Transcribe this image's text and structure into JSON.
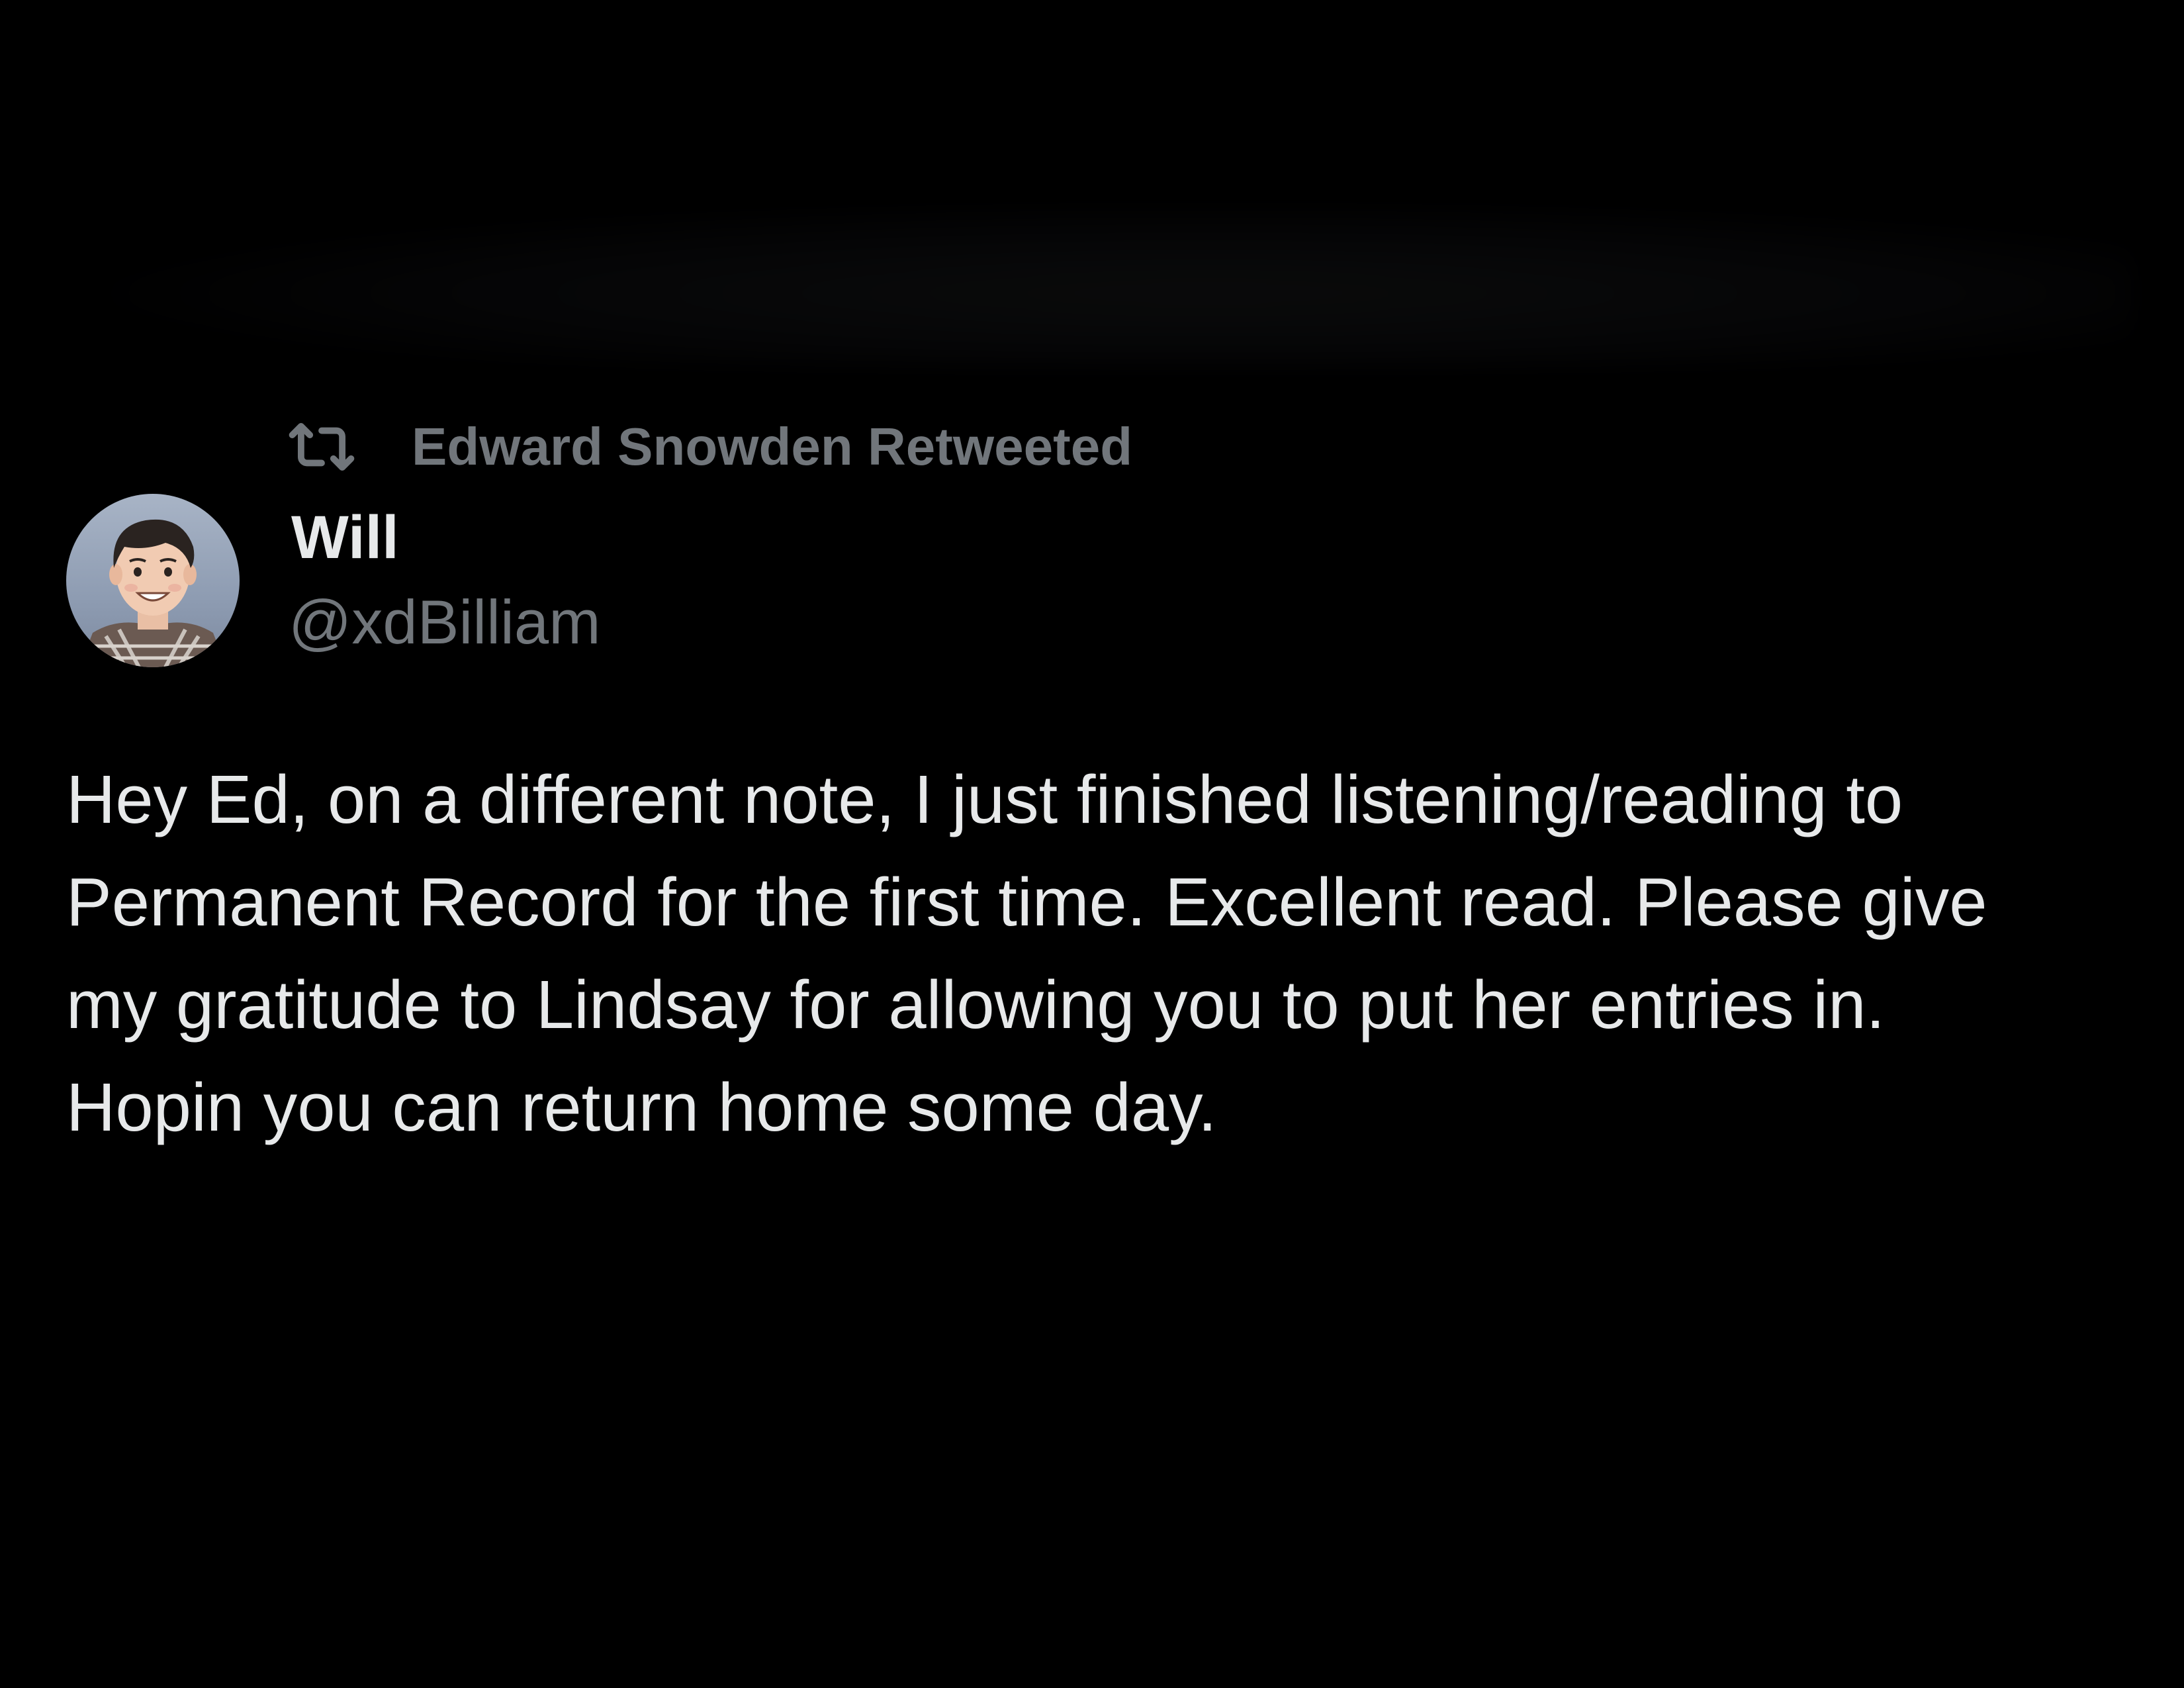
{
  "retweet": {
    "icon": "retweet-icon",
    "label": "Edward Snowden Retweeted"
  },
  "author": {
    "avatar": "avatar",
    "name": "Will",
    "handle": "@xdBilliam"
  },
  "tweet": {
    "lines": [
      "Hey Ed, on a different note, I just finished listening/reading to",
      "Permanent Record for the first time. Excellent read. Please give",
      "my gratitude to Lindsay for allowing you to put her entries in.",
      "Hopin you can return home some day."
    ]
  },
  "colors": {
    "background": "#000000",
    "primary_text": "#e7e9ea",
    "secondary_text": "#71767b"
  }
}
